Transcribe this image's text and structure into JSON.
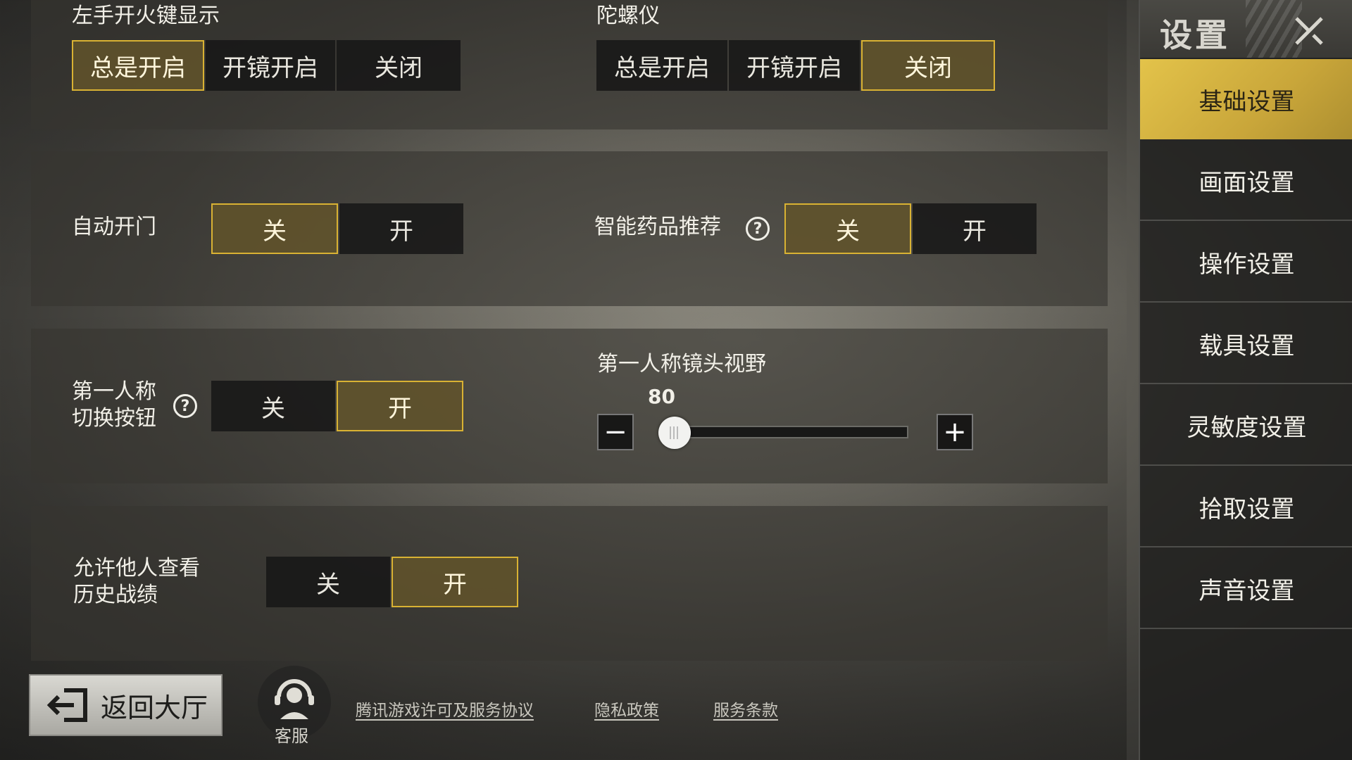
{
  "sections": {
    "left_fire": {
      "label": "左手开火键显示",
      "options": [
        "总是开启",
        "开镜开启",
        "关闭"
      ],
      "selected": 0
    },
    "gyro": {
      "label": "陀螺仪",
      "options": [
        "总是开启",
        "开镜开启",
        "关闭"
      ],
      "selected": 2
    },
    "auto_door": {
      "label": "自动开门",
      "options": [
        "关",
        "开"
      ],
      "selected": 0
    },
    "smart_meds": {
      "label": "智能药品推荐",
      "options": [
        "关",
        "开"
      ],
      "selected": 0
    },
    "fpp_toggle": {
      "label_line1": "第一人称",
      "label_line2": "切换按钮",
      "options": [
        "关",
        "开"
      ],
      "selected": 1
    },
    "fpp_fov": {
      "label": "第一人称镜头视野",
      "value": "80",
      "minus": "−",
      "plus": "+",
      "fraction": 0.05
    },
    "history": {
      "label_line1": "允许他人查看",
      "label_line2": "历史战绩",
      "options": [
        "关",
        "开"
      ],
      "selected": 1
    }
  },
  "help_glyph": "?",
  "sidebar": {
    "title": "设置",
    "items": [
      "基础设置",
      "画面设置",
      "操作设置",
      "载具设置",
      "灵敏度设置",
      "拾取设置",
      "声音设置"
    ],
    "active": 0
  },
  "footer": {
    "back_label": "返回大厅",
    "cs_label": "客服",
    "links": [
      "腾讯游戏许可及服务协议",
      "隐私政策",
      "服务条款"
    ]
  },
  "colors": {
    "accent": "#d9b233",
    "active_fill": "#62542a",
    "sidebar_active": "#e3c34a"
  }
}
